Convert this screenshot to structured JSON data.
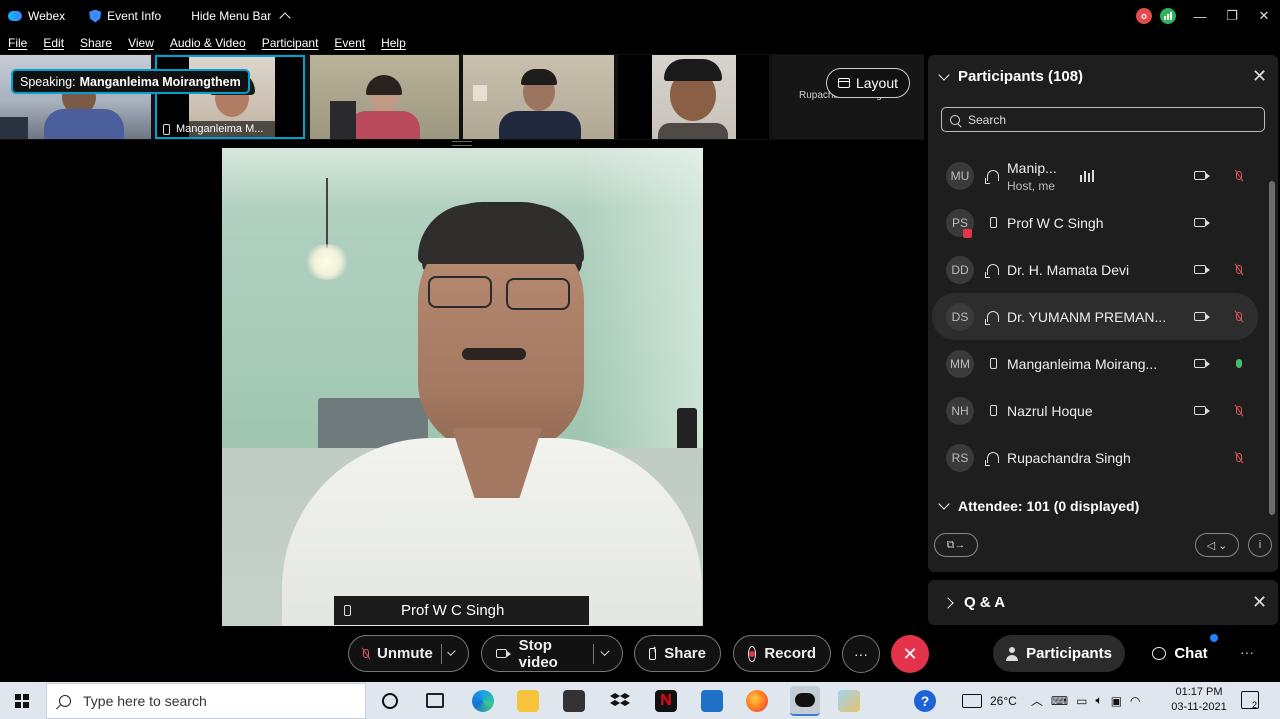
{
  "titlebar": {
    "app_name": "Webex",
    "event_info": "Event Info",
    "hide_menu": "Hide Menu Bar",
    "avatar_initial": "o"
  },
  "menu": [
    "File",
    "Edit",
    "Share",
    "View",
    "Audio & Video",
    "Participant",
    "Event",
    "Help"
  ],
  "filmstrip": {
    "speaking_prefix": "Speaking:",
    "speaking_name": "Manganleima Moirangthem",
    "thumb2_label": "Manganleima M...",
    "thumb6_label": "Rupachandra Singh",
    "layout_label": "Layout"
  },
  "main_video": {
    "name": "Prof W C Singh"
  },
  "participants": {
    "title": "Participants (108)",
    "search_placeholder": "Search",
    "rows": [
      {
        "initials": "MU",
        "name": "Manip...",
        "sub": "Host, me"
      },
      {
        "initials": "PS",
        "name": "Prof W C Singh"
      },
      {
        "initials": "DD",
        "name": "Dr. H. Mamata Devi"
      },
      {
        "initials": "DS",
        "name": "Dr. YUMANM PREMAN..."
      },
      {
        "initials": "MM",
        "name": "Manganleima Moirang..."
      },
      {
        "initials": "NH",
        "name": "Nazrul Hoque"
      },
      {
        "initials": "RS",
        "name": "Rupachandra Singh"
      }
    ],
    "attendee": "Attendee: 101 (0 displayed)"
  },
  "qa": {
    "title": "Q & A"
  },
  "controls": {
    "unmute": "Unmute",
    "stop_video": "Stop video",
    "share": "Share",
    "record": "Record",
    "participants": "Participants",
    "chat": "Chat"
  },
  "taskbar": {
    "search_placeholder": "Type here to search",
    "temperature": "26°C",
    "time": "01:17 PM",
    "date": "03-11-2021",
    "notification_count": "2"
  }
}
